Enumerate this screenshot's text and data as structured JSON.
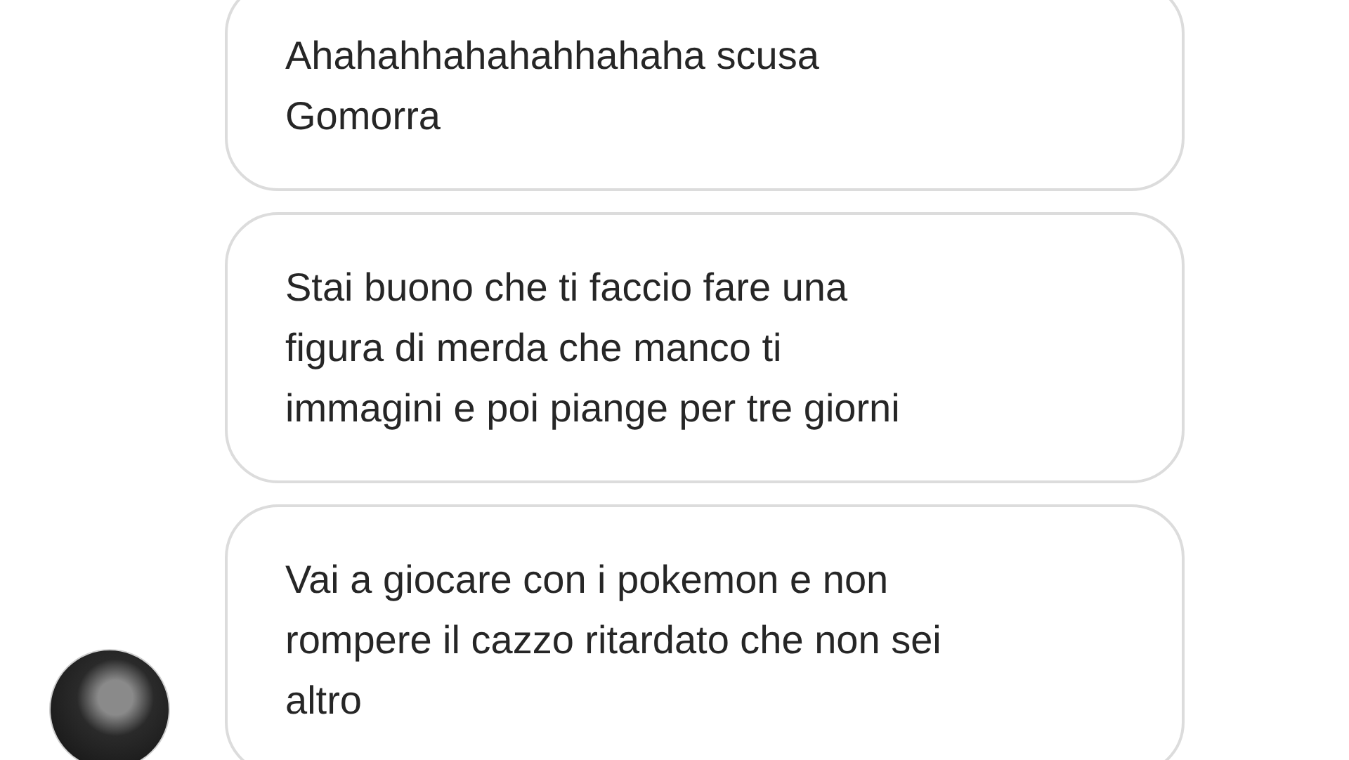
{
  "messages": [
    {
      "text": "Ahahahhahahahhahaha scusa\nGomorra",
      "avatar": false
    },
    {
      "text": "Stai buono che ti faccio fare una\nfigura di merda che manco ti\nimmagini e poi piange per tre giorni",
      "avatar": false
    },
    {
      "text": "Vai a giocare con i pokemon e non\nrompere il cazzo ritardato che non sei\naltro",
      "avatar": true
    }
  ]
}
